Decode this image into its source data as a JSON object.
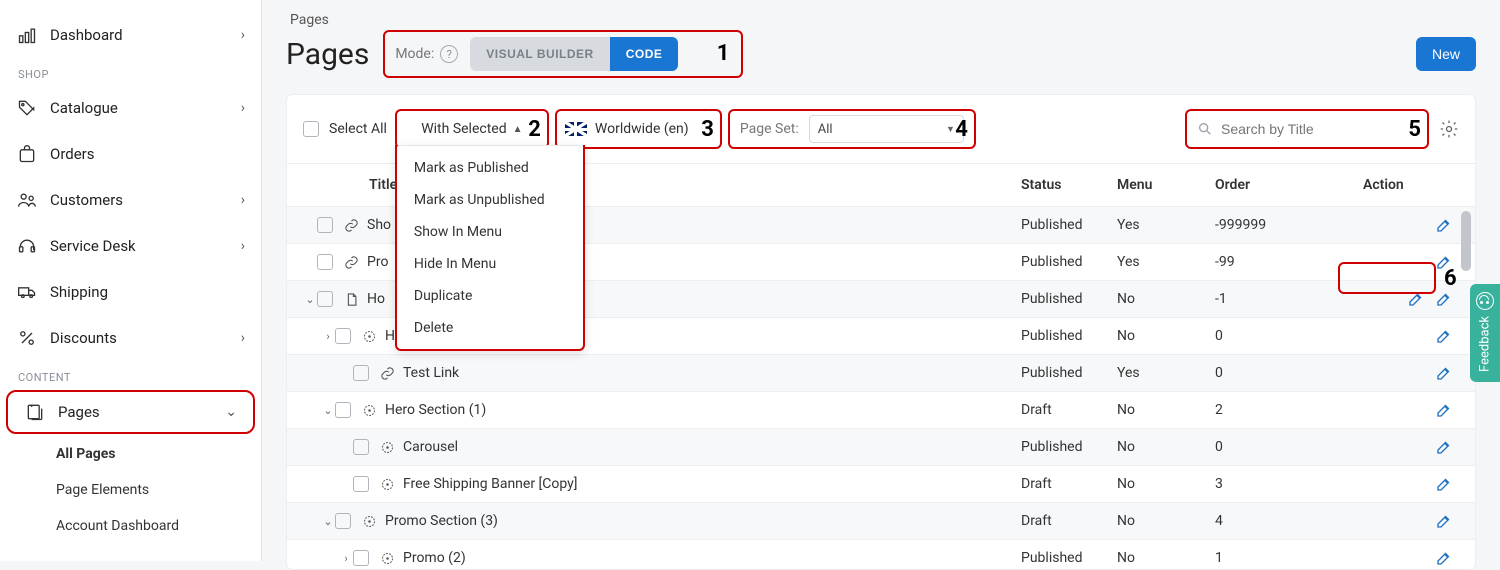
{
  "sidebar": {
    "dashboard": "Dashboard",
    "shop_group": "SHOP",
    "catalogue": "Catalogue",
    "orders": "Orders",
    "customers": "Customers",
    "service_desk": "Service Desk",
    "shipping": "Shipping",
    "discounts": "Discounts",
    "content_group": "CONTENT",
    "pages": "Pages",
    "sub_all": "All Pages",
    "sub_elements": "Page Elements",
    "sub_account": "Account Dashboard"
  },
  "header": {
    "crumb": "Pages",
    "title": "Pages",
    "mode_label": "Mode:",
    "mode_visual": "VISUAL BUILDER",
    "mode_code": "CODE",
    "new_btn": "New"
  },
  "toolbar": {
    "select_all": "Select All",
    "with_selected": "With Selected",
    "locale": "Worldwide (en)",
    "pageset_label": "Page Set:",
    "pageset_value": "All",
    "search_placeholder": "Search by Title"
  },
  "dropdown": {
    "items": [
      "Mark as Published",
      "Mark as Unpublished",
      "Show In Menu",
      "Hide In Menu",
      "Duplicate",
      "Delete"
    ]
  },
  "cols": {
    "title": "Title",
    "status": "Status",
    "menu": "Menu",
    "order": "Order",
    "action": "Action"
  },
  "rows": [
    {
      "indent": 0,
      "expand": "",
      "icon": "link",
      "title": "Sho",
      "title_hidden": true,
      "status": "Published",
      "menu": "Yes",
      "order": "-999999",
      "alt": true,
      "extra_edit": false
    },
    {
      "indent": 0,
      "expand": "",
      "icon": "link",
      "title": "Pro",
      "title_hidden": true,
      "status": "Published",
      "menu": "Yes",
      "order": "-99",
      "alt": false,
      "extra_edit": false
    },
    {
      "indent": 0,
      "expand": "v",
      "icon": "page",
      "title": "Ho",
      "title_hidden": true,
      "status": "Published",
      "menu": "No",
      "order": "-1",
      "alt": true,
      "extra_edit": true
    },
    {
      "indent": 1,
      "expand": ">",
      "icon": "comp",
      "title": "H",
      "title_hidden": true,
      "status": "Published",
      "menu": "No",
      "order": "0",
      "alt": false,
      "extra_edit": false
    },
    {
      "indent": 2,
      "expand": "",
      "icon": "link",
      "title": "Test Link",
      "title_hidden": false,
      "status": "Published",
      "menu": "Yes",
      "order": "0",
      "alt": true,
      "extra_edit": false
    },
    {
      "indent": 1,
      "expand": "v",
      "icon": "comp",
      "title": "Hero Section (1)",
      "title_hidden": false,
      "status": "Draft",
      "menu": "No",
      "order": "2",
      "alt": false,
      "extra_edit": false
    },
    {
      "indent": 2,
      "expand": "",
      "icon": "comp",
      "title": "Carousel",
      "title_hidden": false,
      "status": "Published",
      "menu": "No",
      "order": "0",
      "alt": true,
      "extra_edit": false
    },
    {
      "indent": 2,
      "expand": "",
      "icon": "comp",
      "title": "Free Shipping Banner [Copy]",
      "title_hidden": false,
      "status": "Draft",
      "menu": "No",
      "order": "3",
      "alt": false,
      "extra_edit": false
    },
    {
      "indent": 1,
      "expand": "v",
      "icon": "comp",
      "title": "Promo Section (3)",
      "title_hidden": false,
      "status": "Draft",
      "menu": "No",
      "order": "4",
      "alt": true,
      "extra_edit": false
    },
    {
      "indent": 2,
      "expand": ">",
      "icon": "comp",
      "title": "Promo (2)",
      "title_hidden": false,
      "status": "Published",
      "menu": "No",
      "order": "1",
      "alt": false,
      "extra_edit": false
    }
  ],
  "callouts": {
    "c1": "1",
    "c2": "2",
    "c3": "3",
    "c4": "4",
    "c5": "5",
    "c6": "6"
  },
  "feedback": "Feedback"
}
